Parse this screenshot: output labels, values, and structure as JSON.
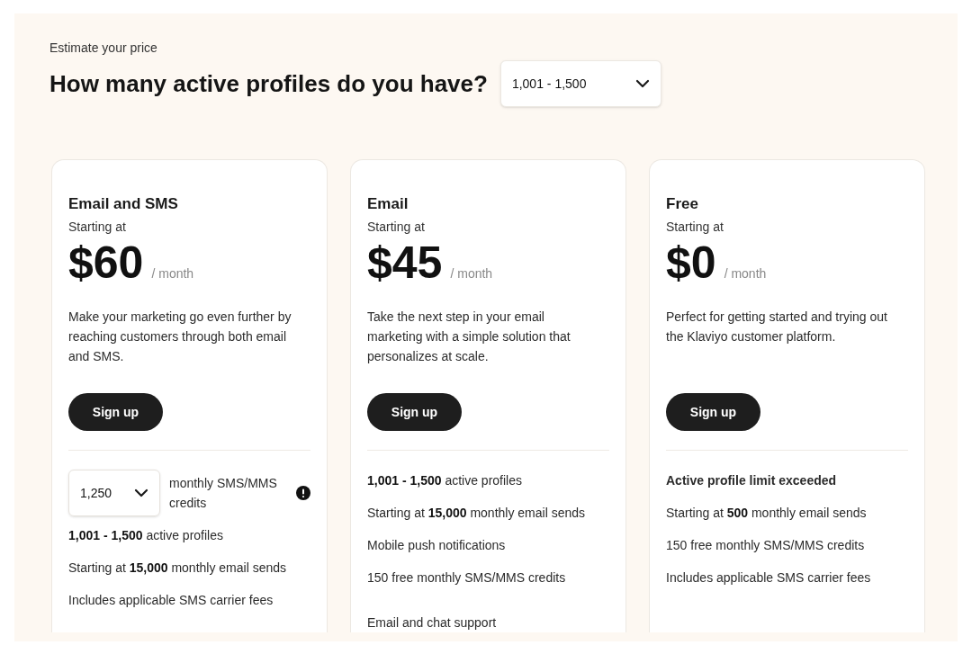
{
  "eyebrow": "Estimate your price",
  "question": "How many active profiles do you have?",
  "profiles_select": {
    "value": "1,001 - 1,500"
  },
  "plans": [
    {
      "name": "Email and SMS",
      "starting": "Starting at",
      "price": "$60",
      "period": "/ month",
      "description": "Make your marketing go even further by reaching customers through both email and SMS.",
      "button": "Sign up",
      "sms_select": {
        "value": "1,250",
        "label": "monthly SMS/MMS credits"
      },
      "features": [
        {
          "kind": "item",
          "text": "**1,001 - 1,500** active profiles"
        },
        {
          "kind": "item",
          "text": "Starting at **15,000** monthly email sends"
        },
        {
          "kind": "item",
          "text": "Includes applicable SMS carrier fees"
        }
      ]
    },
    {
      "name": "Email",
      "starting": "Starting at",
      "price": "$45",
      "period": "/ month",
      "description": "Take the next step in your email marketing with a simple solution that personalizes at scale.",
      "button": "Sign up",
      "features": [
        {
          "kind": "item",
          "text": "**1,001 - 1,500** active profiles"
        },
        {
          "kind": "item",
          "text": "Starting at **15,000** monthly email sends"
        },
        {
          "kind": "item",
          "text": "Mobile push notifications"
        },
        {
          "kind": "item",
          "text": "150 free monthly SMS/MMS credits"
        },
        {
          "kind": "spaced",
          "text": "Email and chat support"
        }
      ]
    },
    {
      "name": "Free",
      "starting": "Starting at",
      "price": "$0",
      "period": "/ month",
      "description": "Perfect for getting started and trying out the Klaviyo customer platform.",
      "button": "Sign up",
      "features": [
        {
          "kind": "alert",
          "text": "Active profile limit exceeded"
        },
        {
          "kind": "item",
          "text": "Starting at **500** monthly email sends"
        },
        {
          "kind": "item",
          "text": "150 free monthly SMS/MMS credits"
        },
        {
          "kind": "item",
          "text": "Includes applicable SMS carrier fees"
        }
      ]
    }
  ]
}
